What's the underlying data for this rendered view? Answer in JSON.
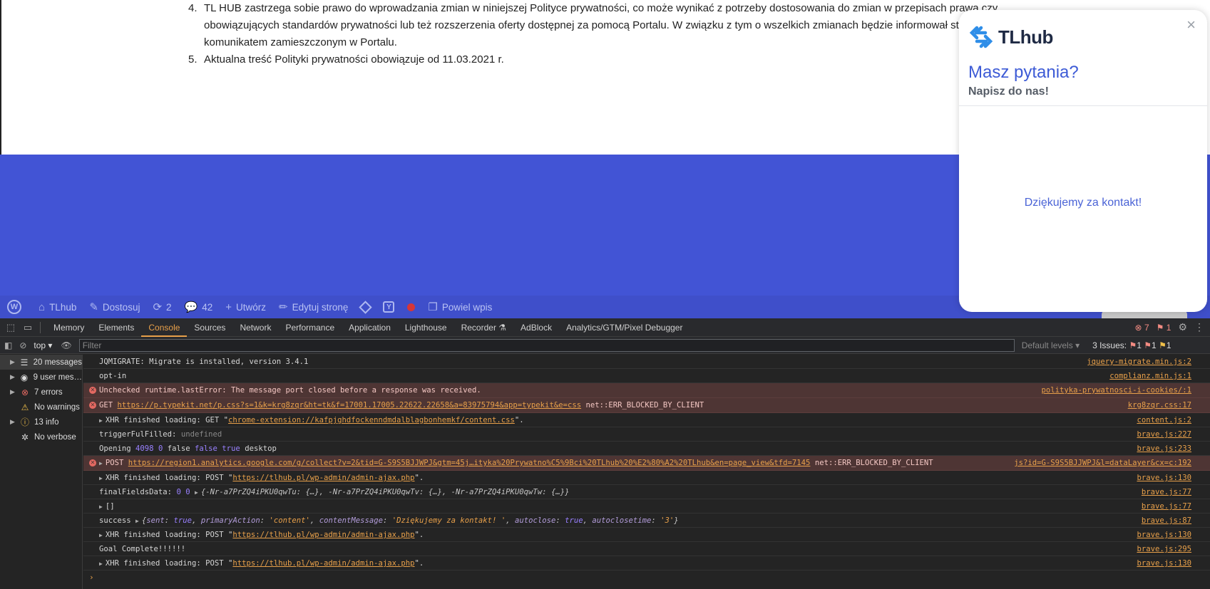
{
  "policy": {
    "items": [
      {
        "num": "4.",
        "text": "TL HUB zastrzega sobie prawo do wprowadzania zmian w niniejszej Polityce prywatności, co może wynikać z potrzeby dostosowania do zmian w przepisach prawa czy obowiązujących standardów prywatności lub też rozszerzenia oferty dostępnej za pomocą Portalu. W związku z tym o wszelkich zmianach będzie informował stosownym komunikatem zamieszczonym w Portalu."
      },
      {
        "num": "5.",
        "text": "Aktualna treść Polityki prywatności obowiązuje od 11.03.2021 r."
      }
    ]
  },
  "adminbar": {
    "site": "TLhub",
    "customize": "Dostosuj",
    "updates": "2",
    "comments": "42",
    "new": "Utwórz",
    "edit": "Edytuj stronę",
    "duplicate": "Powiel wpis"
  },
  "chat": {
    "brand": "TLhub",
    "title": "Masz pytania?",
    "subtitle": "Napisz do nas!",
    "thanks": "Dziękujemy za kontakt!",
    "close": "×"
  },
  "devtools": {
    "tabs": [
      "Memory",
      "Elements",
      "Console",
      "Sources",
      "Network",
      "Performance",
      "Application",
      "Lighthouse",
      "Recorder ⚗",
      "AdBlock",
      "Analytics/GTM/Pixel Debugger"
    ],
    "active_tab": "Console",
    "error_count": "7",
    "warn_count": "1",
    "context": "top",
    "filter_placeholder": "Filter",
    "levels": "Default levels",
    "issues_label": "3 Issues:",
    "issues": [
      "1",
      "1",
      "1"
    ],
    "sidebar": [
      {
        "label": "20 messages",
        "icon": "list"
      },
      {
        "label": "9 user mes…",
        "icon": "user"
      },
      {
        "label": "7 errors",
        "icon": "error"
      },
      {
        "label": "No warnings",
        "icon": "warning"
      },
      {
        "label": "13 info",
        "icon": "info"
      },
      {
        "label": "No verbose",
        "icon": "bug"
      }
    ],
    "console": {
      "r1": {
        "text": "JQMIGRATE: Migrate is installed, version 3.4.1",
        "src": "jquery-migrate.min.js:2"
      },
      "r2": {
        "text": "opt-in",
        "src": "complianz.min.js:1"
      },
      "r3": {
        "text": "Unchecked runtime.lastError: The message port closed before a response was received.",
        "src": "polityka-prywatnosci-i-cookies/:1"
      },
      "r4": {
        "method": "GET",
        "url": "https://p.typekit.net/p.css?s=1&k=krg8zqr&ht=tk&f=17001.17005.22622.22658&a=83975794&app=typekit&e=css",
        "err": "net::ERR_BLOCKED_BY_CLIENT",
        "src": "krg8zqr.css:17"
      },
      "r5": {
        "pre": "XHR finished loading: GET \"",
        "url": "chrome-extension://kafpjghdfockenndmdalblagbonhemkf/content.css",
        "post": "\".",
        "src": "content.js:2"
      },
      "r6": {
        "label": "triggerFulFilled:",
        "val": "undefined",
        "src": "brave.js:227"
      },
      "r7": {
        "label": "Opening",
        "n1": "4098",
        "n2": "0",
        "b1": "false",
        "b2": "false",
        "b3": "true",
        "tail": "desktop",
        "src": "brave.js:233"
      },
      "r8": {
        "method": "POST",
        "url": "https://region1.analytics.google.com/g/collect?v=2&tid=G-S9S5BJJWPJ&gtm=45j…ityka%20Prywatno%C5%9Bci%20TLhub%20%E2%80%A2%20TLhub&en=page_view&tfd=7145",
        "err": "net::ERR_BLOCKED_BY_CLIENT",
        "src": "js?id=G-S9S5BJJWPJ&l=dataLayer&cx=c:192"
      },
      "r9": {
        "pre": "XHR finished loading: POST \"",
        "url": "https://tlhub.pl/wp-admin/admin-ajax.php",
        "post": "\".",
        "src": "brave.js:130"
      },
      "r10": {
        "label": "finalFieldsData:",
        "n1": "0",
        "n2": "0",
        "obj": "{-Nr-a7PrZQ4iPKU0qwTu: {…}, -Nr-a7PrZQ4iPKU0qwTv: {…}, -Nr-a7PrZQ4iPKU0qwTw: {…}}",
        "src": "brave.js:77"
      },
      "r11": {
        "text": "[]",
        "src": "brave.js:77"
      },
      "r12": {
        "label": "success",
        "k1": "sent",
        "v1": "true",
        "k2": "primaryAction",
        "v2": "'content'",
        "k3": "contentMessage",
        "v3": "'Dziękujemy za kontakt! '",
        "k4": "autoclose",
        "v4": "true",
        "k5": "autoclosetime",
        "v5": "'3'",
        "src": "brave.js:87"
      },
      "r13": {
        "pre": "XHR finished loading: POST \"",
        "url": "https://tlhub.pl/wp-admin/admin-ajax.php",
        "post": "\".",
        "src": "brave.js:130"
      },
      "r14": {
        "text": "Goal Complete!!!!!!",
        "src": "brave.js:295"
      },
      "r15": {
        "pre": "XHR finished loading: POST \"",
        "url": "https://tlhub.pl/wp-admin/admin-ajax.php",
        "post": "\".",
        "src": "brave.js:130"
      }
    }
  },
  "colors": {
    "blue_band": "#4254d5",
    "chat_accent": "#3d5bd6",
    "devtools_accent": "#e8a04a",
    "error_row": "#4e3534"
  }
}
